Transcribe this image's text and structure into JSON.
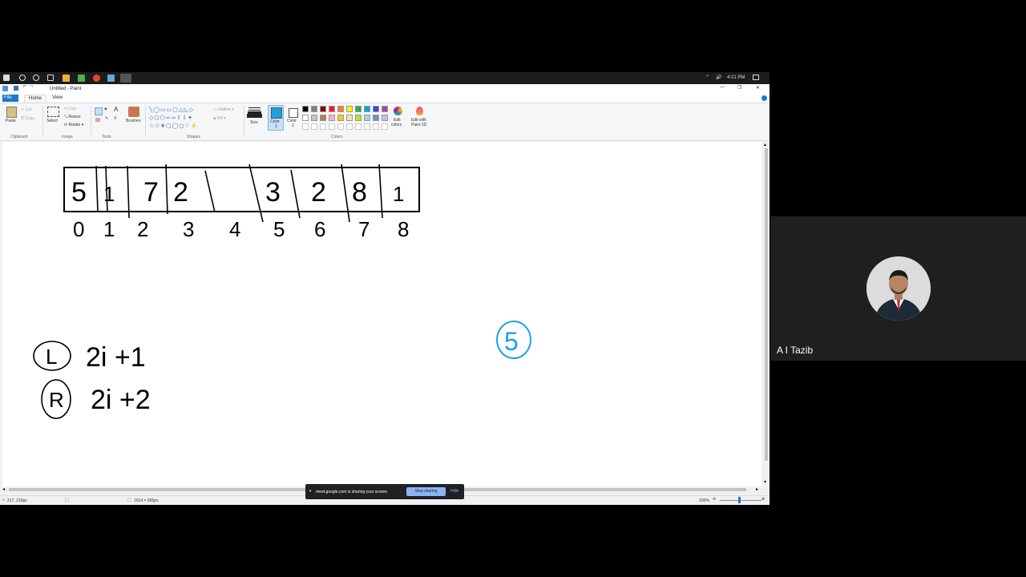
{
  "taskbar": {
    "time": "4:21 PM"
  },
  "window": {
    "title": "Untitled - Paint"
  },
  "menu": {
    "file": "File",
    "home": "Home",
    "view": "View"
  },
  "ribbon": {
    "clipboard": {
      "paste": "Paste",
      "cut": "Cut",
      "copy": "Copy",
      "label": "Clipboard"
    },
    "image": {
      "select": "Select",
      "crop": "Crop",
      "resize": "Resize",
      "rotate": "Rotate",
      "label": "Image"
    },
    "tools": {
      "label": "Tools"
    },
    "brushes": {
      "label": "Brushes"
    },
    "shapes": {
      "outline": "Outline",
      "fill": "Fill",
      "label": "Shapes"
    },
    "size": {
      "label": "Size"
    },
    "color1": {
      "label1": "Color",
      "label2": "1"
    },
    "color2": {
      "label1": "Color",
      "label2": "2"
    },
    "colors_label": "Colors",
    "edit_colors": {
      "line1": "Edit",
      "line2": "colors"
    },
    "paint3d": {
      "line1": "Edit with",
      "line2": "Paint 3D"
    },
    "palette": [
      "#000000",
      "#7f7f7f",
      "#880015",
      "#ed1c24",
      "#ff7f27",
      "#fff200",
      "#22b14c",
      "#00a2e8",
      "#3f48cc",
      "#a349a4",
      "#ffffff",
      "#c3c3c3",
      "#b97a57",
      "#ffaec9",
      "#ffc90e",
      "#efe4b0",
      "#b5e61d",
      "#99d9ea",
      "#7092be",
      "#c8bfe7"
    ],
    "color1_value": "#1ba1e2"
  },
  "drawing": {
    "array_values": [
      "5",
      "1",
      "7",
      "2",
      "",
      "3",
      "2",
      "8",
      "1"
    ],
    "indices": [
      "0",
      "1",
      "2",
      "3",
      "4",
      "5",
      "6",
      "7",
      "8"
    ],
    "left_label": "L",
    "left_formula": "2i +1",
    "right_label": "R",
    "right_formula": "2i +2",
    "circled_value": "5",
    "ink_color": "#000000",
    "blue_ink": "#1ba1e2"
  },
  "status": {
    "cursor": "217, 219px",
    "canvas_size": "1914 × 905px",
    "zoom": "100%"
  },
  "share": {
    "message": "meet.google.com is sharing your screen.",
    "stop": "Stop sharing",
    "hide": "Hide"
  },
  "participant": {
    "name": "A I Tazib"
  }
}
